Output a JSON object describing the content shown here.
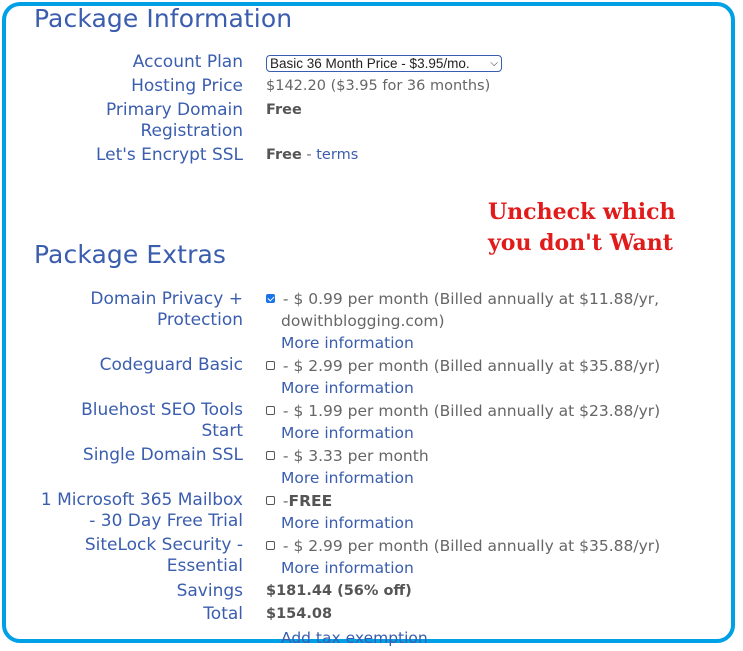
{
  "package_info": {
    "title": "Package Information",
    "account_plan": {
      "label": "Account Plan",
      "selected": "Basic 36 Month Price - $3.95/mo."
    },
    "hosting_price": {
      "label": "Hosting Price",
      "value": "$142.20  ($3.95 for 36 months)"
    },
    "primary_domain": {
      "label_line1": "Primary Domain",
      "label_line2": "Registration",
      "value": "Free"
    },
    "ssl": {
      "label": "Let's Encrypt SSL",
      "value": "Free",
      "separator": " - ",
      "link": "terms"
    }
  },
  "annotation": {
    "line1": "Uncheck which",
    "line2": "you don't Want",
    "color": "#e11a1a"
  },
  "package_extras": {
    "title": "Package Extras",
    "more_info_label": "More information",
    "items": [
      {
        "label_line1": "Domain Privacy +",
        "label_line2": "Protection",
        "checked": true,
        "price": " - $ 0.99 per month (Billed annually at $11.88/yr,",
        "price_line2": "dowithblogging.com)"
      },
      {
        "label_line1": "Codeguard Basic",
        "checked": false,
        "price": " - $ 2.99 per month (Billed annually at $35.88/yr)"
      },
      {
        "label_line1": "Bluehost SEO Tools",
        "label_line2": "Start",
        "checked": false,
        "price": " - $ 1.99 per month (Billed annually at $23.88/yr)"
      },
      {
        "label_line1": "Single Domain SSL",
        "checked": false,
        "price": " - $ 3.33 per month"
      },
      {
        "label_line1": "1 Microsoft 365 Mailbox",
        "label_line2": "- 30 Day Free Trial",
        "checked": false,
        "price_prefix": " -",
        "price_bold": "FREE"
      },
      {
        "label_line1": "SiteLock Security -",
        "label_line2": "Essential",
        "checked": false,
        "price": " - $ 2.99 per month (Billed annually at $35.88/yr)"
      }
    ]
  },
  "summary": {
    "savings_label": "Savings",
    "savings_value": "$181.44 (56% off)",
    "total_label": "Total",
    "total_value": "$154.08",
    "tax_link": "Add tax exemption"
  },
  "colors": {
    "frame": "#00a0e6",
    "label": "#3a5dae",
    "text": "#666666"
  }
}
